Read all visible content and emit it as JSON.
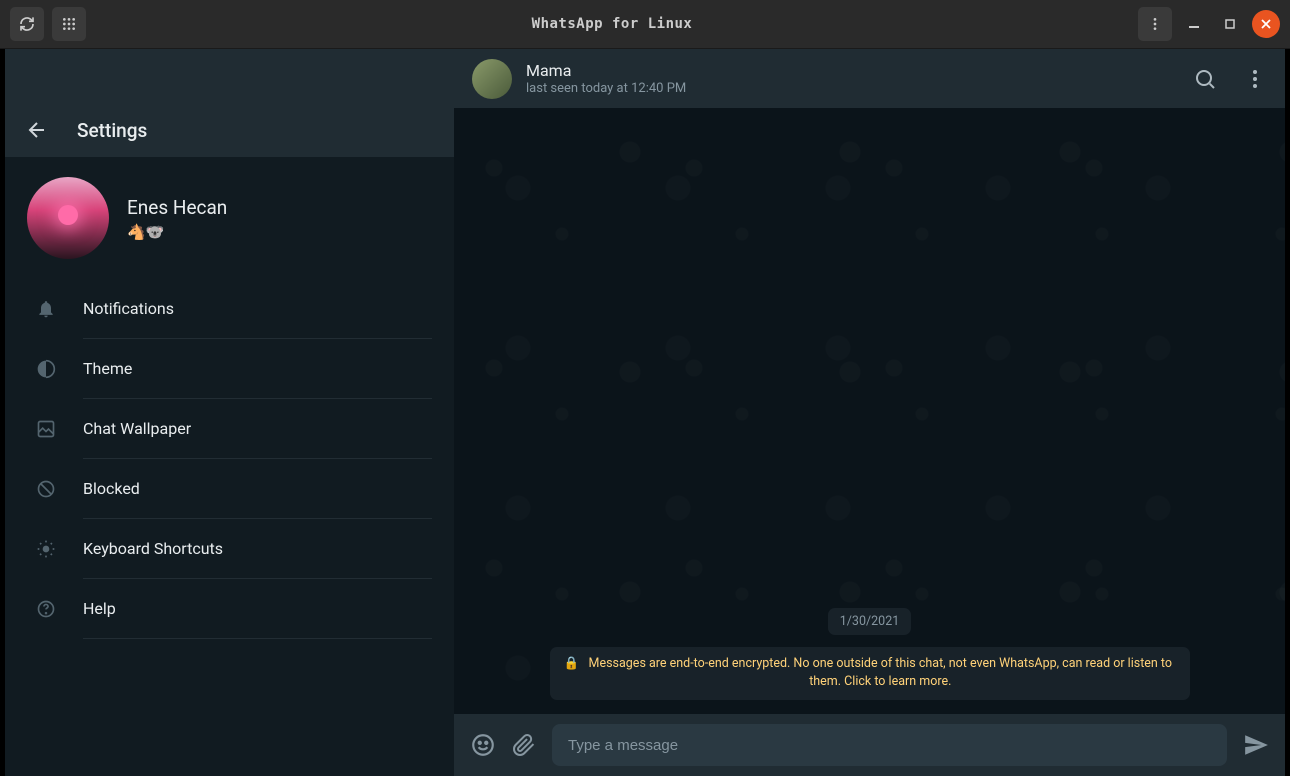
{
  "window": {
    "title": "WhatsApp for Linux"
  },
  "sidebar": {
    "settings_title": "Settings",
    "profile": {
      "name": "Enes Hecan",
      "status": "🐴🐨"
    },
    "items": [
      {
        "label": "Notifications"
      },
      {
        "label": "Theme"
      },
      {
        "label": "Chat Wallpaper"
      },
      {
        "label": "Blocked"
      },
      {
        "label": "Keyboard Shortcuts"
      },
      {
        "label": "Help"
      }
    ]
  },
  "chat": {
    "contact_name": "Mama",
    "last_seen": "last seen today at 12:40 PM",
    "date_label": "1/30/2021",
    "encryption_text": "Messages are end-to-end encrypted. No one outside of this chat, not even WhatsApp, can read or listen to them. Click to learn more.",
    "input_placeholder": "Type a message"
  }
}
